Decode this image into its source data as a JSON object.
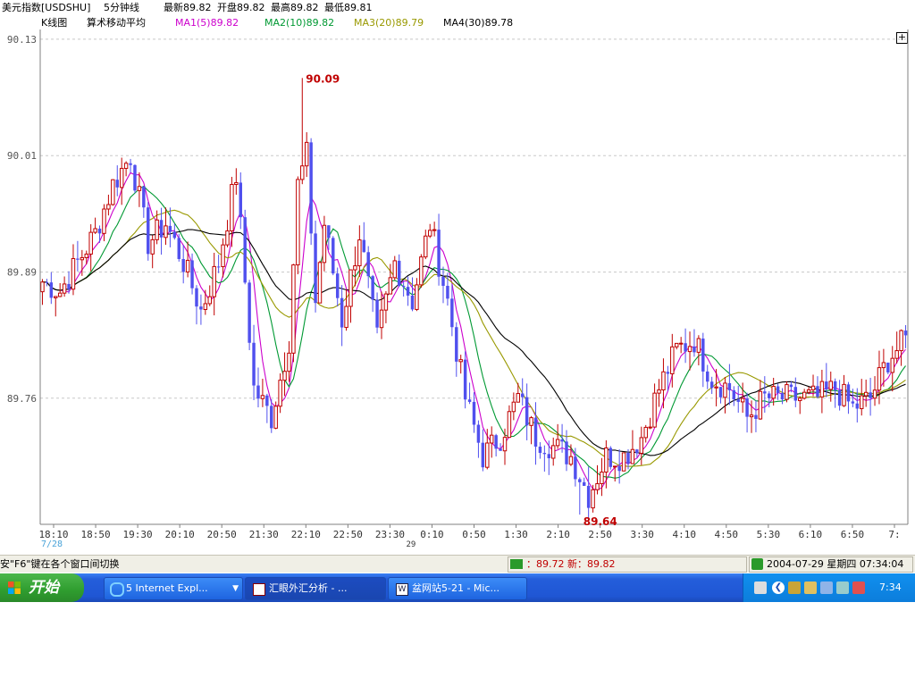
{
  "header": {
    "name": "美元指数[USDSHU]",
    "period": "5分钟线",
    "latest": "最新89.82",
    "open": "开盘89.82",
    "high": "最高89.82",
    "low": "最低89.81"
  },
  "legend": {
    "chart_label": "K线图",
    "method": "算术移动平均",
    "ma1": "MA1(5)89.82",
    "ma2": "MA2(10)89.82",
    "ma3": "MA3(20)89.79",
    "ma4": "MA4(30)89.78",
    "plus": "+"
  },
  "colors": {
    "up": "#c00000",
    "down": "#5050ee",
    "ma1": "#cc00cc",
    "ma2": "#009933",
    "ma3": "#999900",
    "ma4": "#000000",
    "grid": "#c8c8c8"
  },
  "chart_data": {
    "type": "candlestick",
    "y_ticks": [
      "90.13",
      "90.01",
      "89.89",
      "89.76"
    ],
    "ylim": [
      89.63,
      90.14
    ],
    "x_ticks": [
      "18:10",
      "18:50",
      "19:30",
      "20:10",
      "20:50",
      "21:30",
      "22:10",
      "22:50",
      "23:30",
      "0:10",
      "0:50",
      "1:30",
      "2:10",
      "2:50",
      "3:30",
      "4:10",
      "4:50",
      "5:30",
      "6:10",
      "6:50",
      "7:"
    ],
    "date_labels": [
      "7/28",
      "29"
    ],
    "annotations": [
      {
        "text": "90.09",
        "value": 90.09,
        "bar": 59
      },
      {
        "text": "89.64",
        "value": 89.64,
        "bar": 122
      }
    ],
    "anchors": [
      [
        0,
        89.88
      ],
      [
        4,
        89.87
      ],
      [
        8,
        89.9
      ],
      [
        12,
        89.93
      ],
      [
        16,
        89.98
      ],
      [
        20,
        90.01
      ],
      [
        24,
        89.92
      ],
      [
        28,
        89.94
      ],
      [
        32,
        89.9
      ],
      [
        36,
        89.85
      ],
      [
        40,
        89.9
      ],
      [
        44,
        89.99
      ],
      [
        48,
        89.77
      ],
      [
        52,
        89.74
      ],
      [
        56,
        89.82
      ],
      [
        58,
        89.98
      ],
      [
        60,
        90.01
      ],
      [
        62,
        89.86
      ],
      [
        64,
        89.94
      ],
      [
        68,
        89.84
      ],
      [
        72,
        89.93
      ],
      [
        76,
        89.82
      ],
      [
        80,
        89.9
      ],
      [
        84,
        89.86
      ],
      [
        88,
        89.94
      ],
      [
        92,
        89.86
      ],
      [
        96,
        89.76
      ],
      [
        100,
        89.7
      ],
      [
        104,
        89.72
      ],
      [
        108,
        89.76
      ],
      [
        112,
        89.72
      ],
      [
        116,
        89.71
      ],
      [
        120,
        89.7
      ],
      [
        124,
        89.66
      ],
      [
        128,
        89.7
      ],
      [
        132,
        89.7
      ],
      [
        136,
        89.72
      ],
      [
        140,
        89.77
      ],
      [
        144,
        89.81
      ],
      [
        148,
        89.82
      ],
      [
        152,
        89.78
      ],
      [
        156,
        89.77
      ],
      [
        160,
        89.74
      ],
      [
        164,
        89.76
      ],
      [
        168,
        89.76
      ],
      [
        172,
        89.76
      ],
      [
        176,
        89.76
      ],
      [
        180,
        89.77
      ],
      [
        184,
        89.75
      ],
      [
        188,
        89.76
      ],
      [
        192,
        89.8
      ],
      [
        196,
        89.82
      ]
    ]
  },
  "status": {
    "hint": "安\"F6\"键在各个窗口间切换",
    "quote": "：89.72 新：89.82",
    "datetime": "2004-07-29 星期四 07:34:04"
  },
  "taskbar": {
    "start": "开始",
    "task1": "5 Internet Expl...",
    "task2": "汇眼外汇分析 - ...",
    "task3": "盆网站5-21 - Mic...",
    "clock": "7:34"
  }
}
